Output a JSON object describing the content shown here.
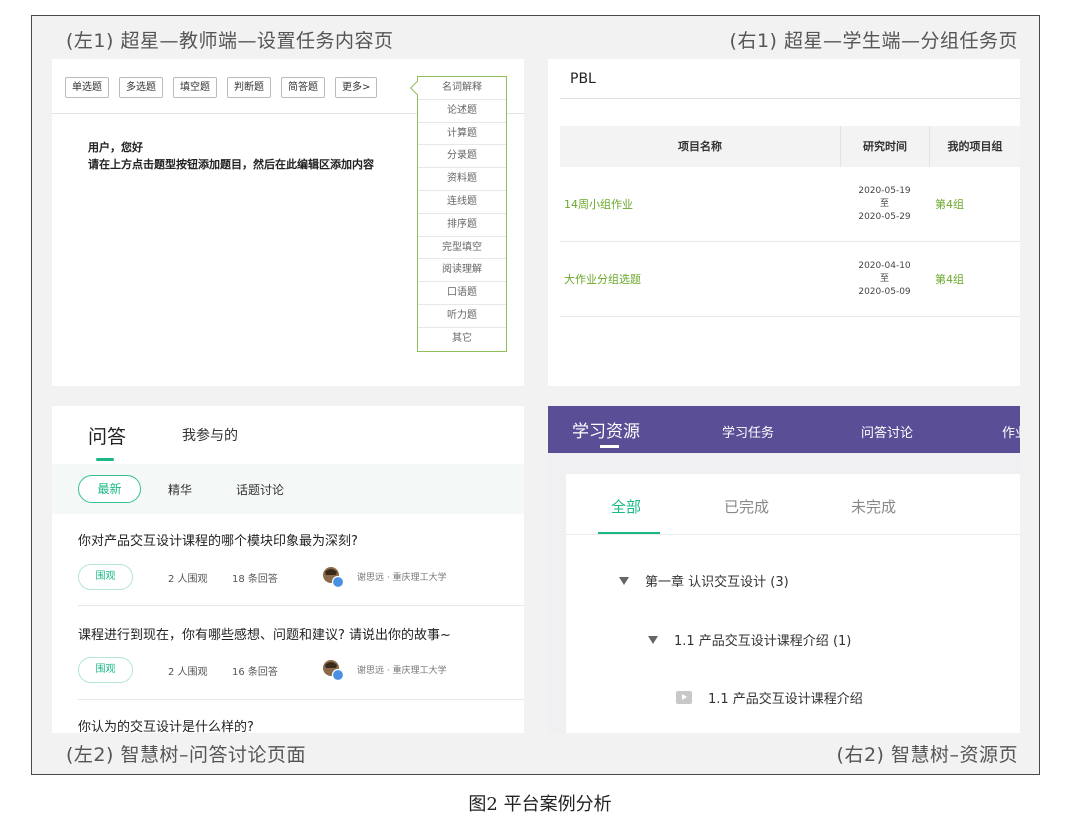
{
  "captions": {
    "left1": "(左1) 超星—教师端—设置任务内容页",
    "right1": "(右1) 超星—学生端—分组任务页",
    "left2": "(左2) 智慧树–问答讨论页面",
    "right2": "(右2) 智慧树–资源页",
    "figure": "图2 平台案例分析"
  },
  "left1": {
    "question_types": [
      "单选题",
      "多选题",
      "填空题",
      "判断题",
      "简答题",
      "更多>"
    ],
    "more_menu": [
      "名词解释",
      "论述题",
      "计算题",
      "分录题",
      "资料题",
      "连线题",
      "排序题",
      "完型填空",
      "阅读理解",
      "口语题",
      "听力题",
      "其它"
    ],
    "greeting": "用户，您好",
    "hint": "请在上方点击题型按钮添加题目，然后在此编辑区添加内容"
  },
  "right1": {
    "title": "PBL",
    "columns": [
      "项目名称",
      "研究时间",
      "我的项目组"
    ],
    "rows": [
      {
        "name": "14周小组作业",
        "start": "2020-05-19",
        "to": "至",
        "end": "2020-05-29",
        "group": "第4组"
      },
      {
        "name": "大作业分组选题",
        "start": "2020-04-10",
        "to": "至",
        "end": "2020-05-09",
        "group": "第4组"
      }
    ]
  },
  "left2": {
    "tabs": [
      "问答",
      "我参与的"
    ],
    "filters": [
      "最新",
      "精华",
      "话题讨论"
    ],
    "questions": [
      {
        "title": "你对产品交互设计课程的哪个模块印象最为深刻?",
        "tag": "围观",
        "watchers": "2 人围观",
        "answers": "18 条回答",
        "author": "谢思远 · 重庆理工大学"
      },
      {
        "title": "课程进行到现在，你有哪些感想、问题和建议? 请说出你的故事~",
        "tag": "围观",
        "watchers": "2 人围观",
        "answers": "16 条回答",
        "author": "谢思远 · 重庆理工大学"
      },
      {
        "title": "你认为的交互设计是什么样的?"
      }
    ]
  },
  "right2": {
    "nav": [
      "学习资源",
      "学习任务",
      "问答讨论",
      "作业"
    ],
    "tabs": [
      "全部",
      "已完成",
      "未完成"
    ],
    "tree": [
      {
        "label": "第一章 认识交互设计 (3)"
      },
      {
        "label": "1.1 产品交互设计课程介绍 (1)"
      },
      {
        "label": "1.1 产品交互设计课程介绍"
      }
    ]
  },
  "colors": {
    "chaoxing_green": "#6aa82a",
    "zhihuishu_green": "#1ab787",
    "zhihuishu_purple": "#5a4f96"
  }
}
